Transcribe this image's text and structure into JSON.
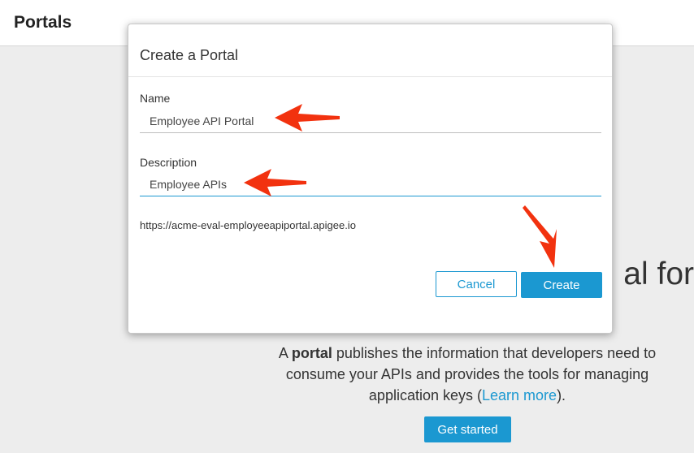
{
  "header": {
    "title": "Portals"
  },
  "background": {
    "heading_fragment": "al for",
    "description_prefix": "A ",
    "description_bold": "portal",
    "description_main": " publishes the information that developers need to consume your APIs and provides the tools for managing application keys (",
    "learn_more_label": "Learn more",
    "description_suffix": ").",
    "get_started_label": "Get started"
  },
  "dialog": {
    "title": "Create a Portal",
    "name_label": "Name",
    "name_value": "Employee API Portal",
    "description_label": "Description",
    "description_value": "Employee APIs",
    "url_preview": "https://acme-eval-employeeapiportal.apigee.io",
    "cancel_label": "Cancel",
    "create_label": "Create"
  },
  "colors": {
    "accent": "#1b98d1",
    "annotation_arrow": "#f2320f"
  }
}
